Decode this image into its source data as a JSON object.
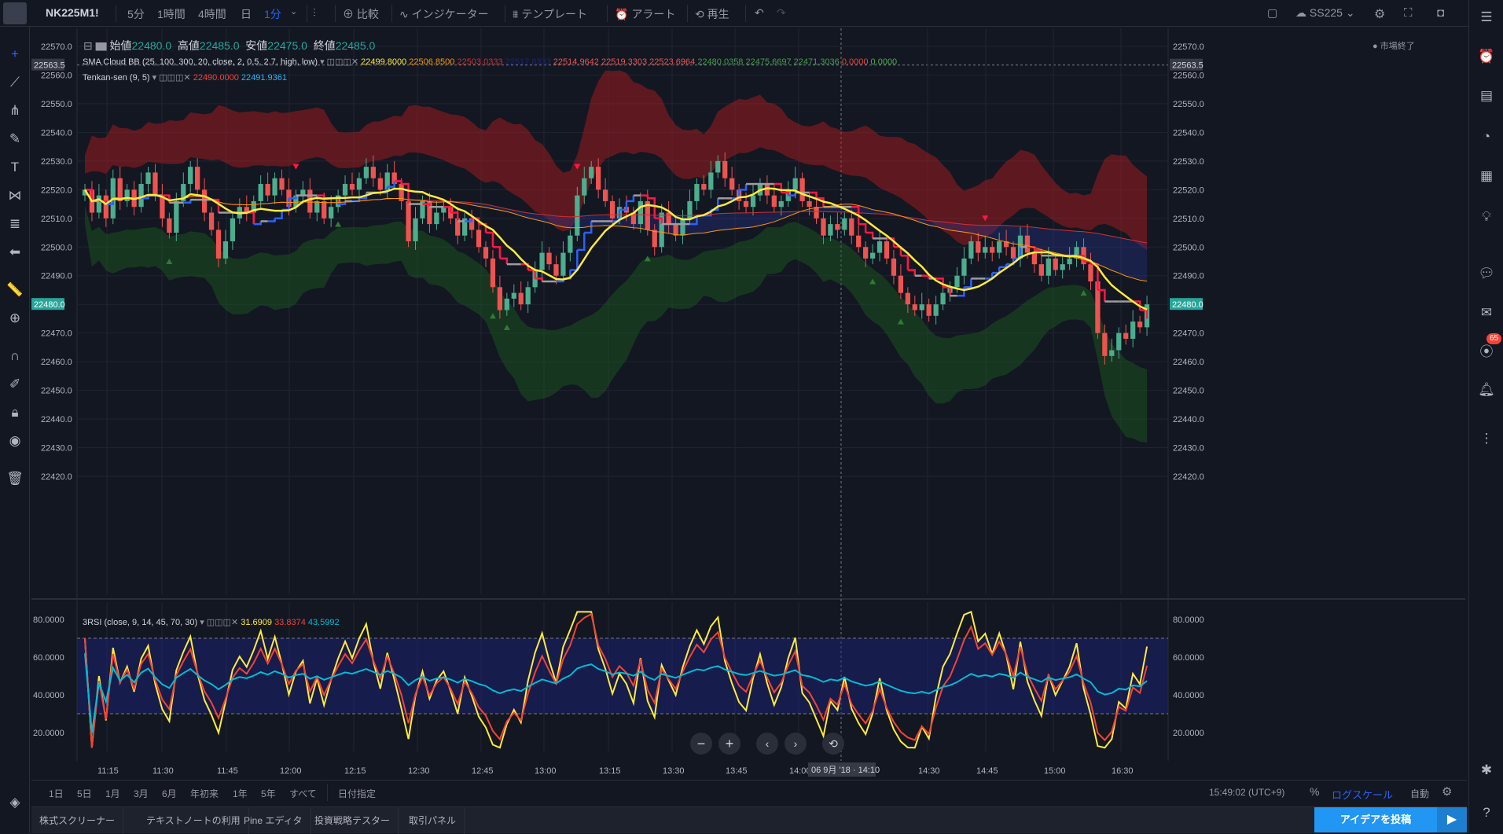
{
  "topbar": {
    "symbol": "NK225M1!",
    "intervals": [
      "5分",
      "1時間",
      "4時間",
      "日",
      "1分"
    ],
    "compare": "比較",
    "indicators": "インジケーター",
    "templates": "テンプレート",
    "alert": "アラート",
    "replay": "再生",
    "cloud_label": "SS225"
  },
  "ohlc": {
    "open_label": "始値",
    "open": "22480.0",
    "high_label": "高値",
    "high": "22485.0",
    "low_label": "安値",
    "low": "22475.0",
    "close_label": "終値",
    "close": "22485.0"
  },
  "market_status": "● 市場終了",
  "indicators": {
    "sma_cloud": {
      "name": "SMA Cloud BB (25, 100, 300, 20, close, 2, 0.5, 2.7, high, low)",
      "values": [
        {
          "v": "22499.8000",
          "color": "#ffeb3b"
        },
        {
          "v": "22506.8500",
          "color": "#ff9800"
        },
        {
          "v": "22503.0333",
          "color": "#d32f2f"
        },
        {
          "v": "22517.8333",
          "color": "#1a237e"
        },
        {
          "v": "22514.9642",
          "color": "#ef5350"
        },
        {
          "v": "22519.3303",
          "color": "#ef5350"
        },
        {
          "v": "22523.6964",
          "color": "#ef5350"
        },
        {
          "v": "22480.0358",
          "color": "#43a047"
        },
        {
          "v": "22475.6697",
          "color": "#43a047"
        },
        {
          "v": "22471.3036",
          "color": "#43a047"
        },
        {
          "v": "0.0000",
          "color": "#f44336"
        },
        {
          "v": "0.0000",
          "color": "#4caf50"
        }
      ]
    },
    "tenkan": {
      "name": "Tenkan-sen (9, 5)",
      "values": [
        {
          "v": "22490.0000",
          "color": "#f44336"
        },
        {
          "v": "22491.9361",
          "color": "#29b6f6"
        }
      ]
    },
    "rsi": {
      "name": "3RSI (close, 9, 14, 45, 70, 30)",
      "values": [
        {
          "v": "31.6909",
          "color": "#ffeb3b"
        },
        {
          "v": "33.8374",
          "color": "#f44336"
        },
        {
          "v": "43.5992",
          "color": "#00bcd4"
        }
      ]
    }
  },
  "price_axis": {
    "labels": [
      "22570.0",
      "22560.0",
      "22550.0",
      "22540.0",
      "22530.0",
      "22520.0",
      "22510.0",
      "22500.0",
      "22490.0",
      "22470.0",
      "22460.0",
      "22450.0",
      "22440.0",
      "22430.0",
      "22420.0"
    ],
    "tag_top": "22563.5",
    "tag_last": "22480.0"
  },
  "rsi_axis": {
    "labels": [
      "80.0000",
      "60.0000",
      "40.0000",
      "20.0000"
    ],
    "upper": 70,
    "lower": 30
  },
  "time_axis": {
    "labels": [
      "11:15",
      "11:30",
      "11:45",
      "12:00",
      "12:15",
      "12:30",
      "12:45",
      "13:00",
      "13:15",
      "13:30",
      "13:45",
      "14:00",
      "14:30",
      "14:45",
      "15:00",
      "16:30"
    ],
    "crosshair_label": "06 9月 '18 · 14:10"
  },
  "bottombar": {
    "ranges": [
      "1日",
      "5日",
      "1月",
      "3月",
      "6月",
      "年初来",
      "1年",
      "5年",
      "すべて",
      "日付指定"
    ],
    "clock": "15:49:02 (UTC+9)",
    "percent": "%",
    "log": "ログスケール",
    "auto": "自動"
  },
  "panels": [
    "株式スクリーナー",
    "テキストノートの利用",
    "Pine エディタ",
    "投資戦略テスター",
    "取引パネル"
  ],
  "idea_button": "アイデアを投稿",
  "notification_count": "65",
  "colors": {
    "background": "#131722",
    "up": "#26a69a",
    "up_candle": "#4cae8e",
    "down_candle": "#ef5350",
    "sma_fast": "#ffeb3b",
    "sma_mid": "#ff9800",
    "sma_slow": "#d32f2f",
    "accent": "#2962ff",
    "rsi_fast": "#ffeb3b",
    "rsi_mid": "#f44336",
    "rsi_slow": "#00bcd4"
  },
  "chart_data": {
    "type": "candlestick",
    "price_range": [
      22415,
      22575
    ],
    "closes": [
      22520,
      22512,
      22518,
      22510,
      22524,
      22516,
      22520,
      22514,
      22522,
      22526,
      22518,
      22510,
      22505,
      22516,
      22522,
      22528,
      22520,
      22512,
      22506,
      22496,
      22502,
      22510,
      22514,
      22512,
      22516,
      22522,
      22518,
      22524,
      22520,
      22514,
      22518,
      22520,
      22512,
      22516,
      22510,
      22514,
      22518,
      22522,
      22520,
      22524,
      22528,
      22524,
      22520,
      22526,
      22522,
      22516,
      22502,
      22510,
      22516,
      22508,
      22512,
      22514,
      22510,
      22504,
      22510,
      22506,
      22500,
      22496,
      22486,
      22478,
      22482,
      22484,
      22480,
      22486,
      22492,
      22498,
      22494,
      22490,
      22498,
      22504,
      22518,
      22524,
      22528,
      22520,
      22516,
      22510,
      22514,
      22512,
      22508,
      22516,
      22506,
      22500,
      22512,
      22508,
      22504,
      22510,
      22516,
      22522,
      22520,
      22526,
      22530,
      22524,
      22520,
      22516,
      22514,
      22518,
      22522,
      22518,
      22514,
      22516,
      22520,
      22524,
      22516,
      22514,
      22510,
      22504,
      22508,
      22506,
      22510,
      22504,
      22500,
      22496,
      22498,
      22502,
      22496,
      22490,
      22484,
      22480,
      22478,
      22480,
      22476,
      22480,
      22484,
      22486,
      22490,
      22496,
      22502,
      22498,
      22500,
      22498,
      22502,
      22500,
      22496,
      22504,
      22498,
      22494,
      22490,
      22496,
      22492,
      22494,
      22496,
      22500,
      22494,
      22488,
      22470,
      22462,
      22464,
      22470,
      22468,
      22474,
      22472,
      22480
    ],
    "rsi_range": [
      10,
      85
    ],
    "rsi": [
      {
        "name": "RSI 9",
        "color": "#ffeb3b"
      },
      {
        "name": "RSI 14",
        "color": "#f44336"
      },
      {
        "name": "RSI 45",
        "color": "#00bcd4"
      }
    ]
  }
}
